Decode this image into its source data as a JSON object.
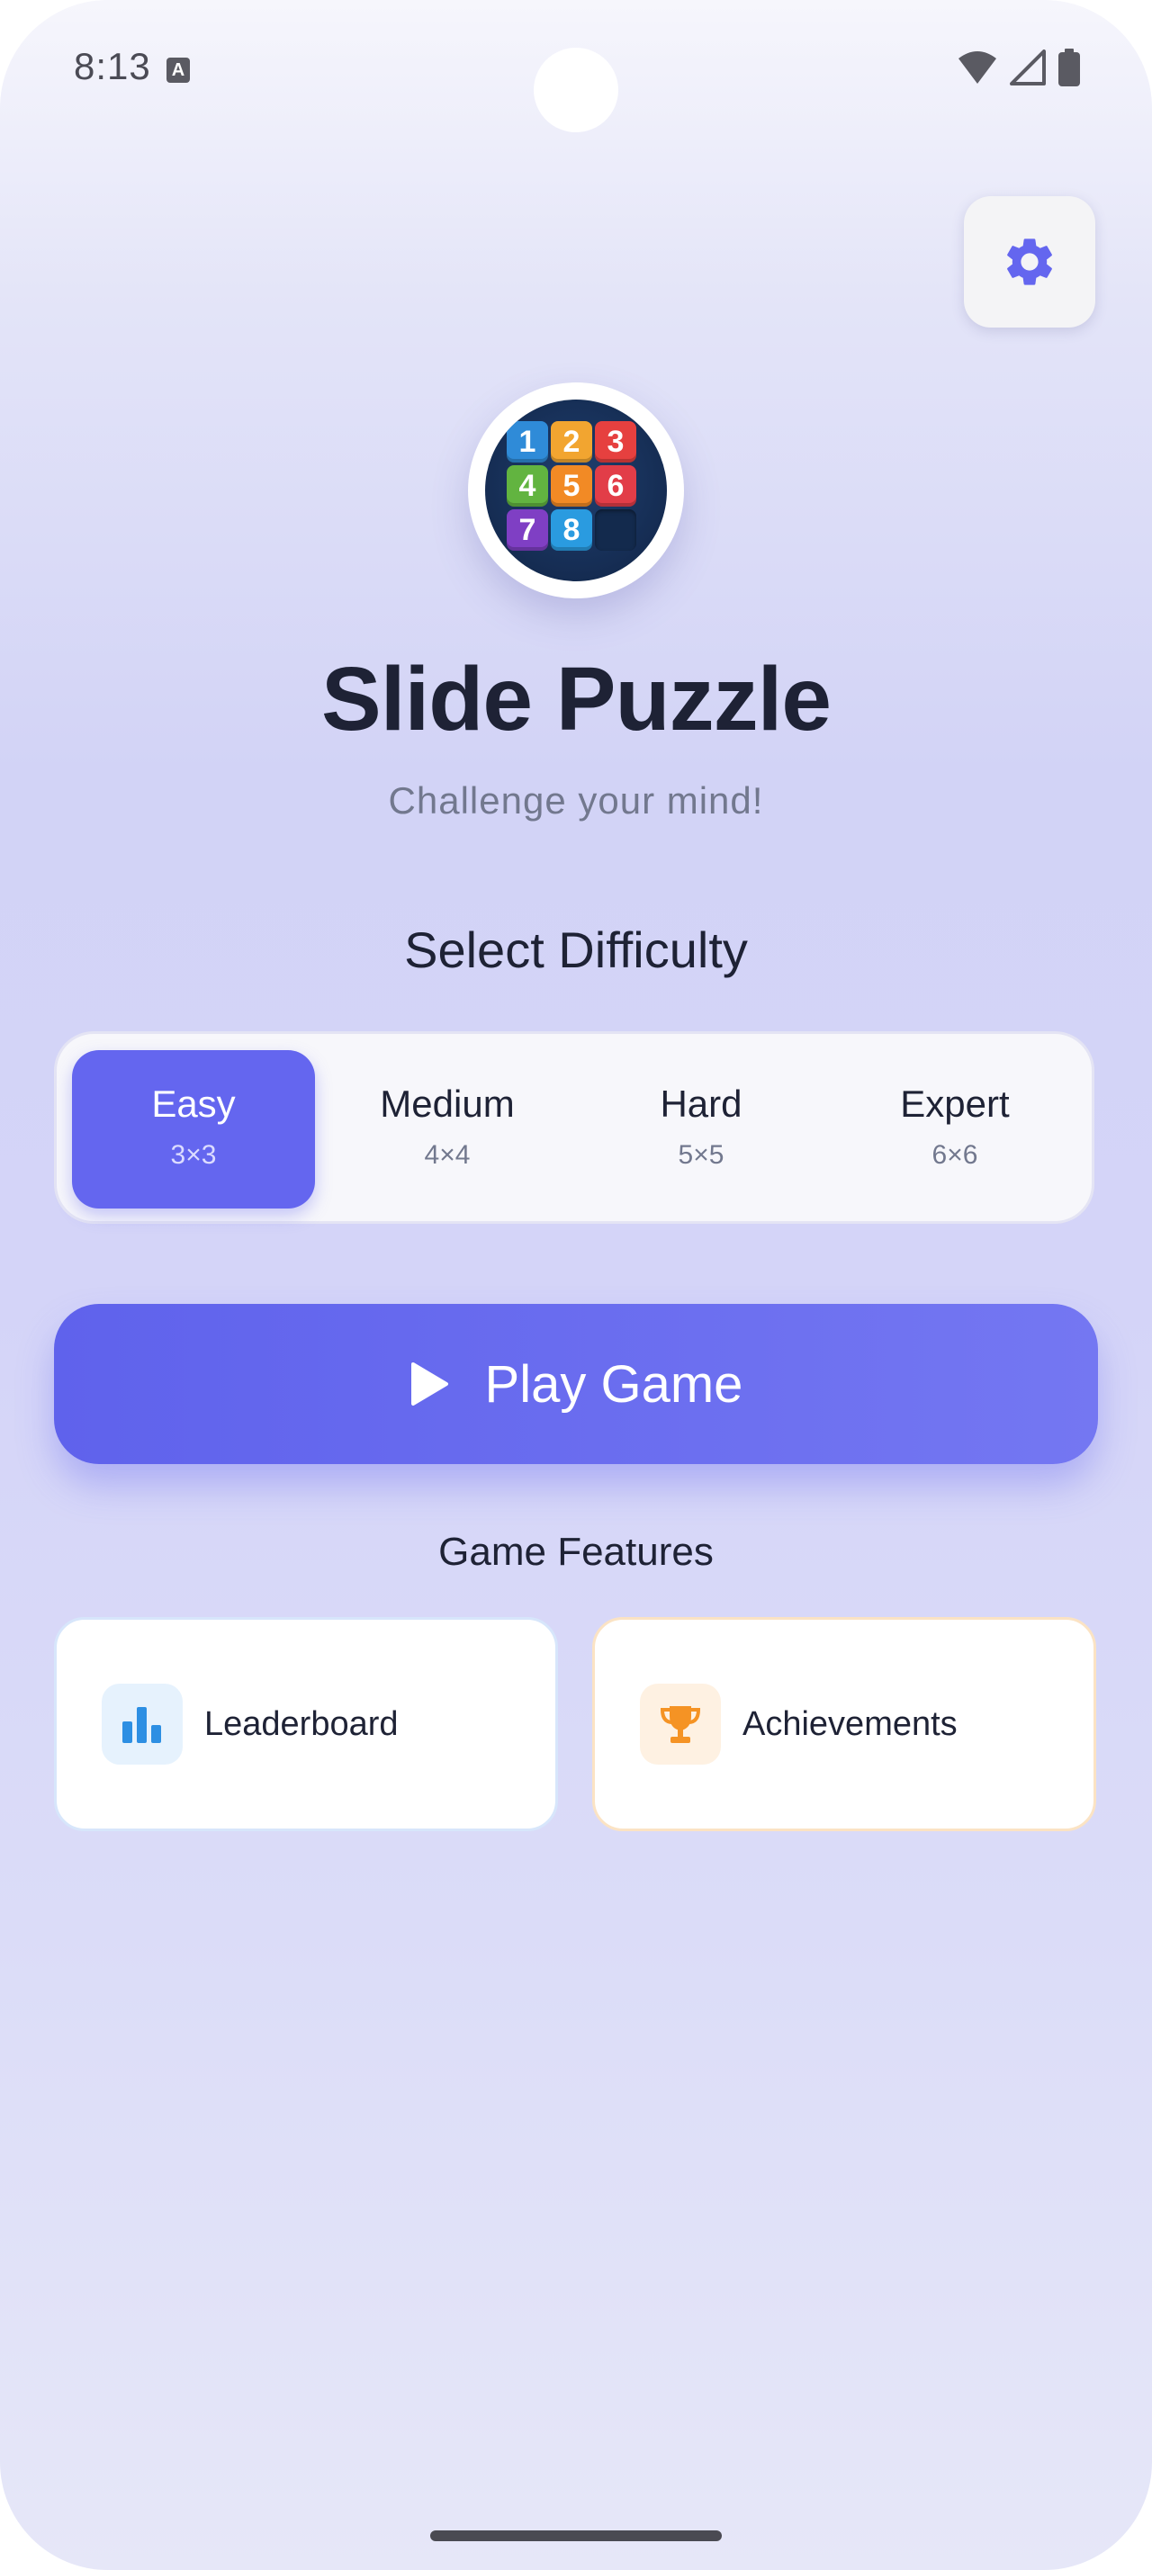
{
  "status_bar": {
    "time": "8:13",
    "notification_icon": "a-icon",
    "icons": [
      "wifi-icon",
      "signal-icon",
      "battery-icon"
    ]
  },
  "header": {
    "settings_icon": "gear-icon"
  },
  "app": {
    "title": "Slide Puzzle",
    "subtitle": "Challenge your mind!",
    "logo_tiles": [
      {
        "label": "1",
        "color": "#2f8bd8"
      },
      {
        "label": "2",
        "color": "#f2a530"
      },
      {
        "label": "3",
        "color": "#e6403f"
      },
      {
        "label": "4",
        "color": "#62b440"
      },
      {
        "label": "5",
        "color": "#f28a25"
      },
      {
        "label": "6",
        "color": "#e23d48"
      },
      {
        "label": "7",
        "color": "#7f3fc4"
      },
      {
        "label": "8",
        "color": "#2a9be0"
      },
      {
        "label": "",
        "color": ""
      }
    ]
  },
  "difficulty": {
    "heading": "Select Difficulty",
    "selected": "Easy",
    "options": [
      {
        "label": "Easy",
        "size": "3×3"
      },
      {
        "label": "Medium",
        "size": "4×4"
      },
      {
        "label": "Hard",
        "size": "5×5"
      },
      {
        "label": "Expert",
        "size": "6×6"
      }
    ]
  },
  "play": {
    "label": "Play Game",
    "icon": "play-icon"
  },
  "features": {
    "heading": "Game Features",
    "items": [
      {
        "label": "Leaderboard",
        "icon": "bar-chart-icon",
        "accent": "#2d8fe3"
      },
      {
        "label": "Achievements",
        "icon": "trophy-icon",
        "accent": "#f59324"
      }
    ]
  },
  "colors": {
    "primary": "#6466ef",
    "text_dark": "#1e2235",
    "text_muted": "#72788e"
  }
}
